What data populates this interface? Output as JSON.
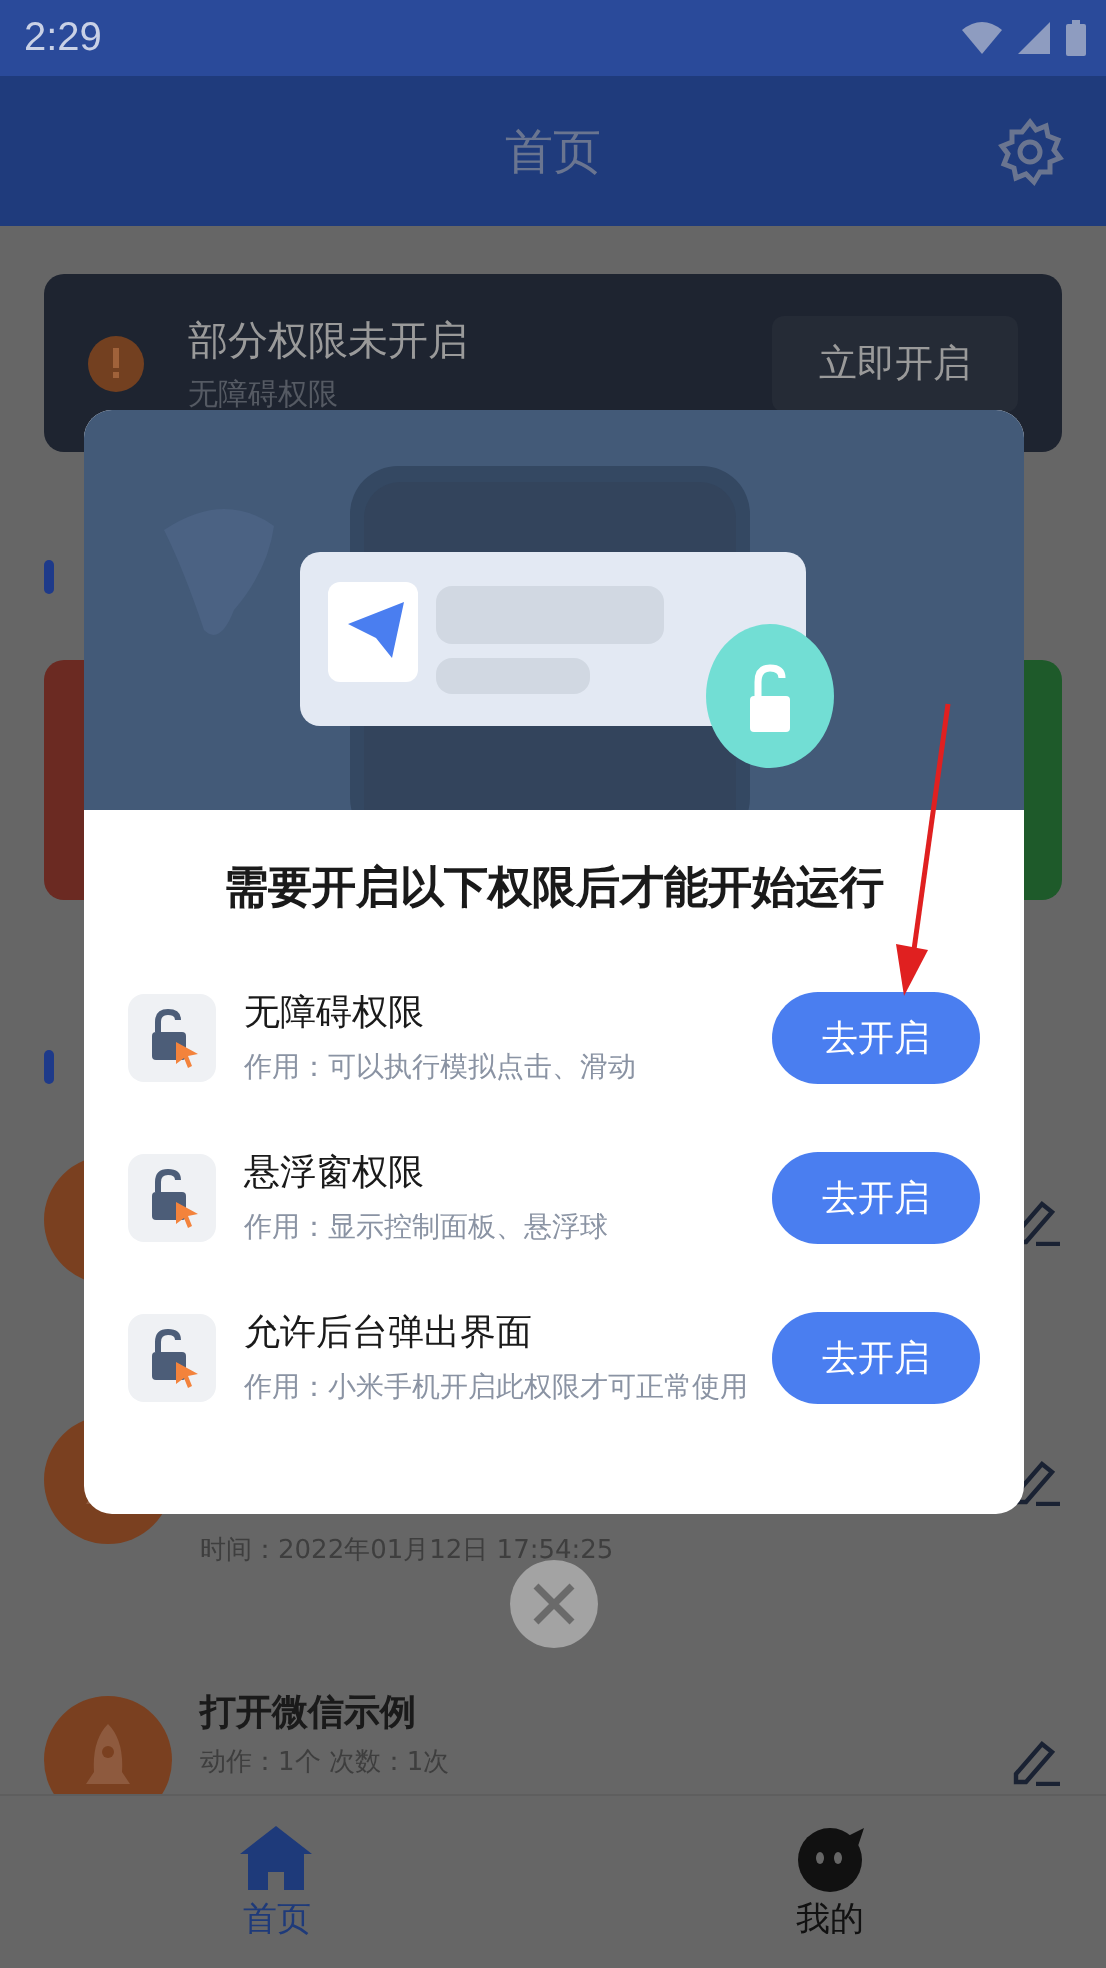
{
  "status_bar": {
    "time": "2:29"
  },
  "header": {
    "title": "首页"
  },
  "banner": {
    "title": "部分权限未开启",
    "subtitle": "无障碍权限",
    "button": "立即开启"
  },
  "list_items": [
    {
      "kind": "hidden"
    },
    {
      "kind": "partial",
      "detail": "时间：2022年01月12日 17:54:25"
    },
    {
      "kind": "full",
      "title": "打开微信示例",
      "detail": "动作：1个 次数：1次"
    }
  ],
  "bottom_nav": [
    {
      "label": "首页",
      "selected": true
    },
    {
      "label": "我的",
      "selected": false
    }
  ],
  "dialog": {
    "title": "需要开启以下权限后才能开始运行",
    "permissions": [
      {
        "name": "无障碍权限",
        "description": "作用：可以执行模拟点击、滑动",
        "button": "去开启"
      },
      {
        "name": "悬浮窗权限",
        "description": "作用：显示控制面板、悬浮球",
        "button": "去开启"
      },
      {
        "name": "允许后台弹出界面",
        "description": "作用：小米手机开启此权限才可正常使用",
        "button": "去开启"
      }
    ]
  }
}
